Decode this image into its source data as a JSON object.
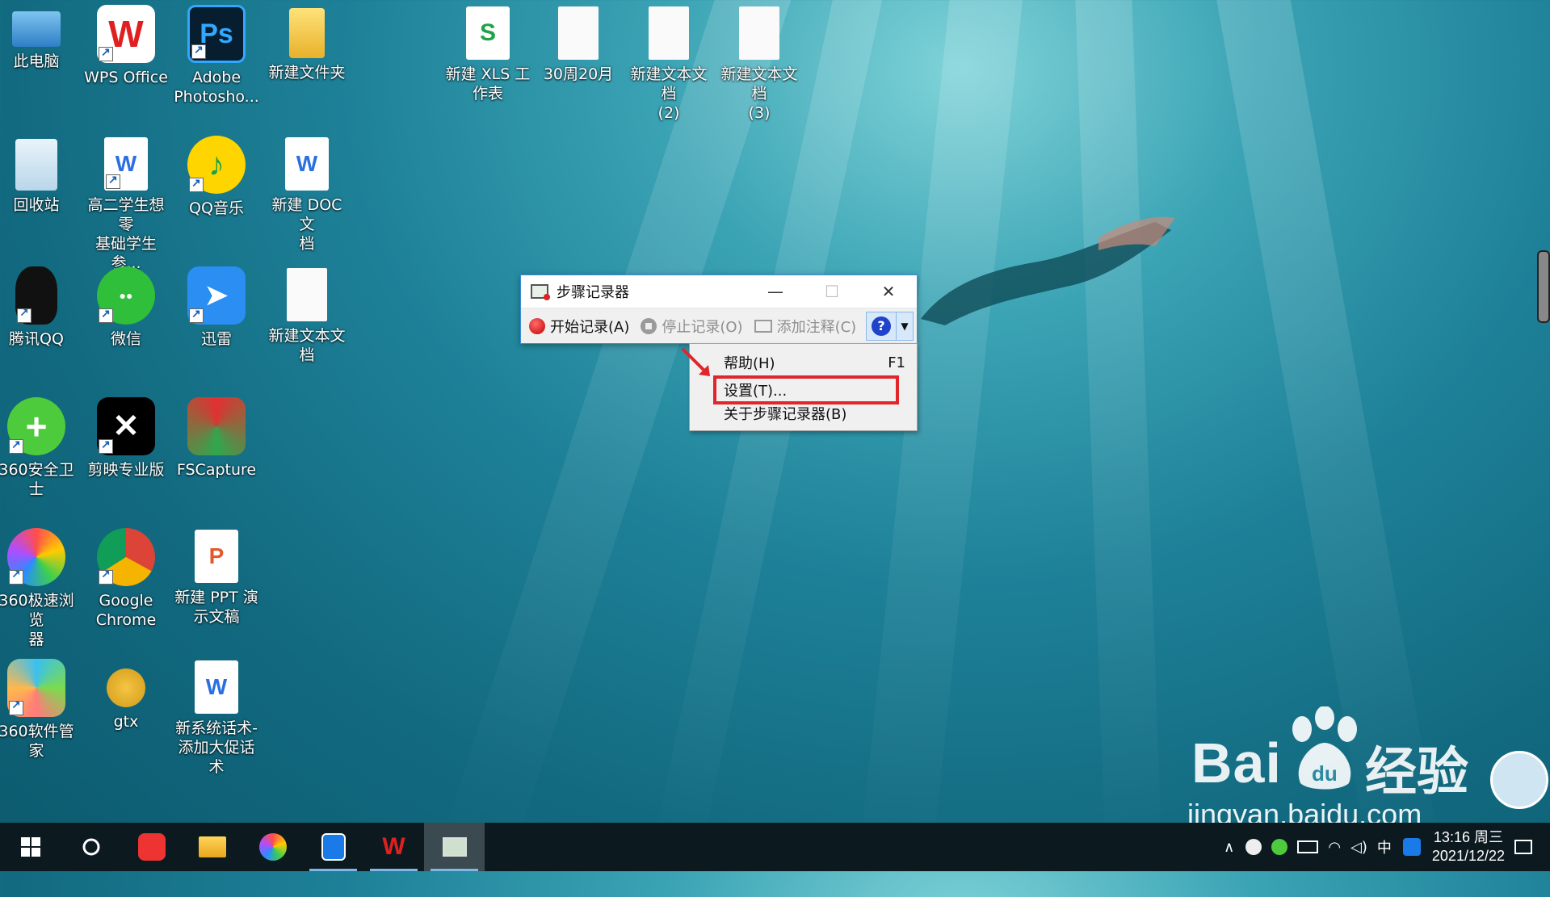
{
  "desktop": {
    "icons": [
      {
        "label": "此电脑",
        "icon": "computer-icon"
      },
      {
        "label": "WPS Office",
        "icon": "wps-icon"
      },
      {
        "label": "Adobe\nPhotosho...",
        "icon": "photoshop-icon"
      },
      {
        "label": "新建文件夹",
        "icon": "folder-icon"
      },
      {
        "label": "新建 XLS 工\n作表",
        "icon": "xls-icon"
      },
      {
        "label": "30周20月",
        "icon": "document-icon"
      },
      {
        "label": "新建文本文档\n(2)",
        "icon": "document-icon"
      },
      {
        "label": "新建文本文档\n(3)",
        "icon": "document-icon"
      },
      {
        "label": "回收站",
        "icon": "recycle-bin-icon"
      },
      {
        "label": "高二学生想零\n基础学生参...",
        "icon": "word-doc-icon"
      },
      {
        "label": "QQ音乐",
        "icon": "qq-music-icon"
      },
      {
        "label": "新建 DOC 文\n档",
        "icon": "word-doc-icon"
      },
      {
        "label": "腾讯QQ",
        "icon": "qq-penguin-icon"
      },
      {
        "label": "微信",
        "icon": "wechat-icon"
      },
      {
        "label": "迅雷",
        "icon": "xunlei-icon"
      },
      {
        "label": "新建文本文档",
        "icon": "document-icon"
      },
      {
        "label": "360安全卫士",
        "icon": "360-security-icon"
      },
      {
        "label": "剪映专业版",
        "icon": "capcut-icon"
      },
      {
        "label": "FSCapture",
        "icon": "fscapture-icon"
      },
      {
        "label": "360极速浏览\n器",
        "icon": "360-browser-icon"
      },
      {
        "label": "Google\nChrome",
        "icon": "chrome-icon"
      },
      {
        "label": "新建 PPT 演\n示文稿",
        "icon": "ppt-icon"
      },
      {
        "label": "360软件管家",
        "icon": "360-software-icon"
      },
      {
        "label": "gtx",
        "icon": "gtx-icon"
      },
      {
        "label": "新系统话术-\n添加大促话术",
        "icon": "word-doc-icon"
      }
    ]
  },
  "recorder": {
    "title": "步骤记录器",
    "minimize": "—",
    "maximize": "☐",
    "close": "✕",
    "start": "开始记录(A)",
    "stop": "停止记录(O)",
    "add_comment": "添加注释(C)",
    "help_glyph": "?",
    "dropdown_glyph": "▼"
  },
  "menu": {
    "items": [
      {
        "label": "帮助(H)",
        "shortcut": "F1"
      },
      {
        "label": "设置(T)...",
        "shortcut": ""
      },
      {
        "label": "关于步骤记录器(B)",
        "shortcut": ""
      }
    ],
    "highlight_color": "#e0262b"
  },
  "watermark": {
    "brand": "Bai",
    "brand_cn": "经验",
    "url": "jingyan.baidu.com"
  },
  "taskbar": {
    "tray_chevron": "∧",
    "ime": "中",
    "time": "13:16 周三",
    "date": "2021/12/22",
    "accent": "#7fb7e8"
  }
}
